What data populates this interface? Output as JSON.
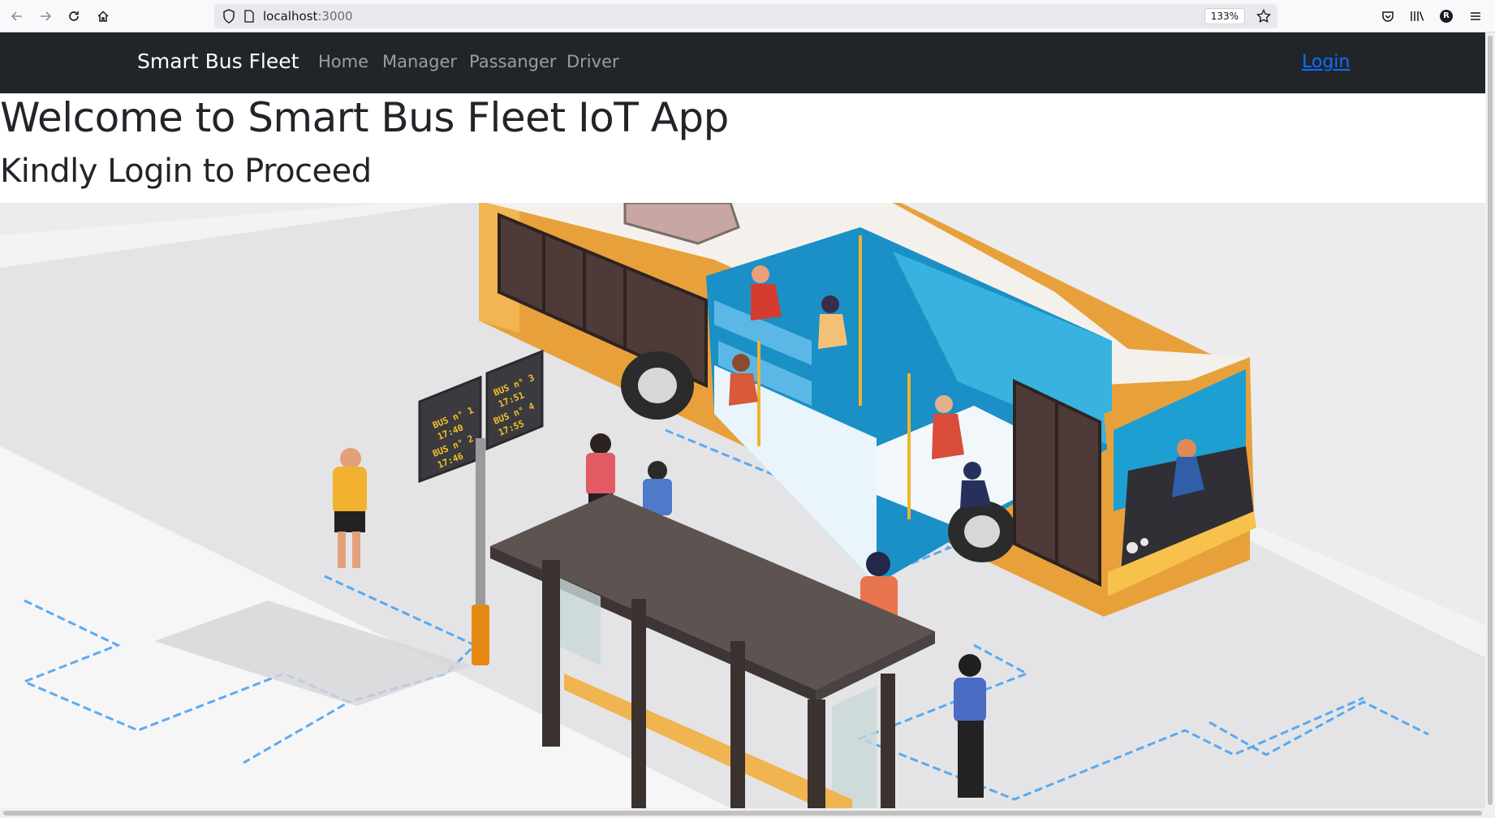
{
  "browser": {
    "url_host": "localhost",
    "url_port": ":3000",
    "zoom": "133%",
    "profile_initial": "R"
  },
  "navbar": {
    "brand": "Smart Bus Fleet",
    "links": [
      "Home",
      "Manager",
      "Passanger",
      "Driver"
    ],
    "login": "Login",
    "background": "#212529",
    "login_color": "#0d6efd"
  },
  "main": {
    "title": "Welcome to Smart Bus Fleet IoT App",
    "subtitle": "Kindly Login to Proceed"
  },
  "illustration": {
    "sign_left_lines": [
      "BUS n° 1",
      "17:40",
      "BUS n° 2",
      "17:46"
    ],
    "sign_right_lines": [
      "BUS n° 3",
      "17:51",
      "BUS n° 4",
      "17:55"
    ]
  }
}
